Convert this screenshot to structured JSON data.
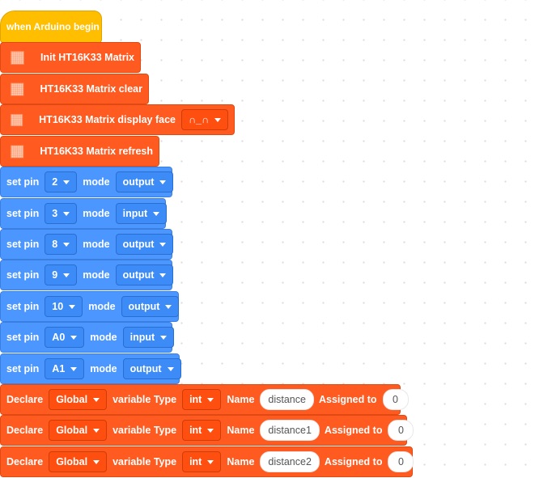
{
  "hat": {
    "label": "when Arduino begin"
  },
  "matrix_blocks": {
    "init": "Init HT16K33 Matrix",
    "clear": "HT16K33 Matrix clear",
    "display_face": "HT16K33 Matrix display face",
    "face_value": "∩_∩",
    "refresh": "HT16K33 Matrix refresh"
  },
  "pin_blocks": [
    {
      "set_label": "set pin",
      "pin": "2",
      "mode_label": "mode",
      "mode": "output"
    },
    {
      "set_label": "set pin",
      "pin": "3",
      "mode_label": "mode",
      "mode": "input"
    },
    {
      "set_label": "set pin",
      "pin": "8",
      "mode_label": "mode",
      "mode": "output"
    },
    {
      "set_label": "set pin",
      "pin": "9",
      "mode_label": "mode",
      "mode": "output"
    },
    {
      "set_label": "set pin",
      "pin": "10",
      "mode_label": "mode",
      "mode": "output"
    },
    {
      "set_label": "set pin",
      "pin": "A0",
      "mode_label": "mode",
      "mode": "input"
    },
    {
      "set_label": "set pin",
      "pin": "A1",
      "mode_label": "mode",
      "mode": "output"
    }
  ],
  "declare_blocks": [
    {
      "declare": "Declare",
      "scope": "Global",
      "vartype_label": "variable Type",
      "type": "int",
      "name_label": "Name",
      "name": "distance",
      "assigned_label": "Assigned to",
      "value": "0"
    },
    {
      "declare": "Declare",
      "scope": "Global",
      "vartype_label": "variable Type",
      "type": "int",
      "name_label": "Name",
      "name": "distance1",
      "assigned_label": "Assigned to",
      "value": "0"
    },
    {
      "declare": "Declare",
      "scope": "Global",
      "vartype_label": "variable Type",
      "type": "int",
      "name_label": "Name",
      "name": "distance2",
      "assigned_label": "Assigned to",
      "value": "0"
    }
  ],
  "colors": {
    "event": "#ffbf00",
    "matrix": "#ff5a1f",
    "pins": "#4c97ff",
    "variables": "#ff5a1f"
  },
  "icons": {
    "matrix": "led-matrix-icon",
    "dropdown": "caret-down-icon"
  }
}
